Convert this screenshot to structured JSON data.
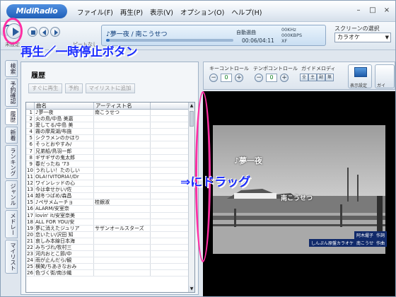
{
  "app": {
    "logo": "MidiRadio",
    "menu": [
      "ファイル(F)",
      "再生(P)",
      "表示(V)",
      "オプション(O)",
      "ヘルプ(H)"
    ],
    "window_controls": [
      "–",
      "□",
      "×"
    ]
  },
  "player": {
    "unset_label": "未設定",
    "repeat_label": "ピートなし",
    "now_playing": "♪夢一夜 / 南こうせつ",
    "station": "自動選曲",
    "time": "00:06/04:11",
    "format_lines": [
      "00KHz",
      "000KBPS",
      "XF"
    ],
    "progress_fraction": 0.03
  },
  "screen_select": {
    "label": "スクリーンの選択",
    "value": "カラオケ"
  },
  "side_tabs": [
    "検索",
    "予約確認",
    "履歴",
    "新着",
    "ランキング",
    "ジャンル",
    "メドレー",
    "マイリスト"
  ],
  "history": {
    "title": "履歴",
    "buttons": [
      "すぐに再生",
      "予約",
      "マイリストに追加"
    ],
    "columns": [
      "",
      "曲名",
      "アーティスト名",
      ""
    ],
    "rows": [
      [
        "1",
        "♪夢一夜",
        "南こうせつ"
      ],
      [
        "2",
        "火の鳥/中島 美嘉",
        ""
      ],
      [
        "3",
        "愛してる/中島 美",
        ""
      ],
      [
        "4",
        "霧の摩周湖/布施",
        ""
      ],
      [
        "5",
        "シクラメンのかほり",
        ""
      ],
      [
        "6",
        "そっとおやすみ/",
        ""
      ],
      [
        "7",
        "兄弟船/鳥羽一郎",
        ""
      ],
      [
        "8",
        "ギザギザの鬼太郎",
        ""
      ],
      [
        "9",
        "春だったね '73",
        ""
      ],
      [
        "10",
        "うれしい！たのしい",
        ""
      ],
      [
        "11",
        "OLA!!VITORIA!/Dr",
        ""
      ],
      [
        "12",
        "ワインレッドの心",
        ""
      ],
      [
        "13",
        "今は幸せかい/佐",
        ""
      ],
      [
        "14",
        "越冬つばめ/森昌",
        ""
      ],
      [
        "15",
        "♪ペサメムーチョ",
        "桂銀淑"
      ],
      [
        "16",
        "ALARM/安室奈",
        ""
      ],
      [
        "17",
        "lovin' it/安室奈美",
        ""
      ],
      [
        "18",
        "ALL FOR YOU/安",
        ""
      ],
      [
        "19",
        "夢に消えたジュリア",
        "サザンオールスターズ"
      ],
      [
        "20",
        "恋いたい/沢田 知",
        ""
      ],
      [
        "21",
        "哀しみ本線日本海",
        ""
      ],
      [
        "22",
        "みちづれ/牧村三",
        ""
      ],
      [
        "23",
        "河内おとこ節/中",
        ""
      ],
      [
        "24",
        "雨が止んだら/観",
        ""
      ],
      [
        "25",
        "横笑/ちあきなおみ",
        ""
      ],
      [
        "26",
        "色づく街/南沙織",
        ""
      ]
    ]
  },
  "controls": {
    "key_label": "キーコントロール",
    "key_value": "0",
    "tempo_label": "テンポコントロール",
    "tempo_value": "0",
    "guide_label": "ガイドメロディ",
    "guide_segments": [
      "全",
      "主",
      "副",
      "無"
    ],
    "display_label": "表示設定",
    "extra_label": "ガイ"
  },
  "video": {
    "song_title": "♪夢一夜",
    "artist": "南こうせつ",
    "lyric_label": "阿木燿子",
    "lyric_role": "作詞",
    "composer_label": "南こうせつ",
    "composer_role": "作曲",
    "original": "しんぷん原盤カラオケ"
  },
  "annotations": {
    "play_note": "再生／一時停止ボタン",
    "drag_note": "⇒にドラッグ"
  }
}
